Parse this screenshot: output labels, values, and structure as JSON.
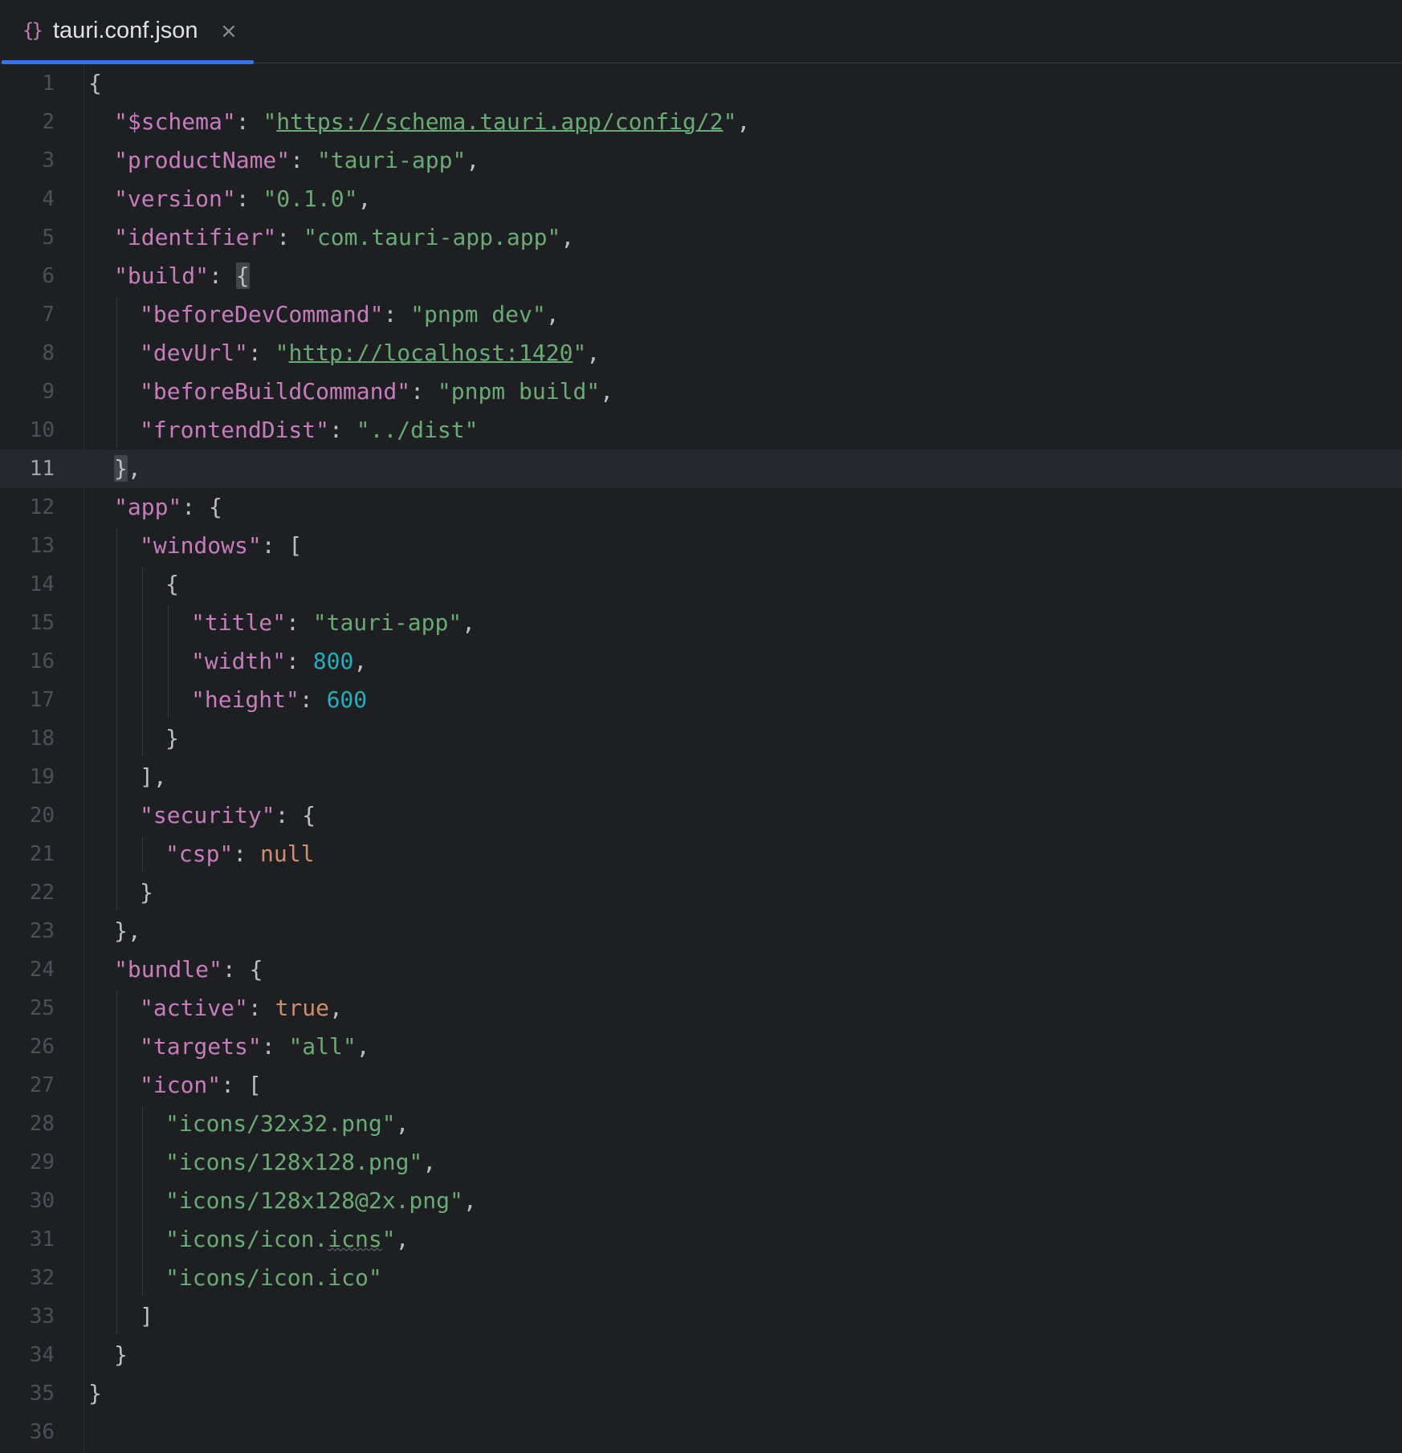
{
  "tab": {
    "icon": "{}",
    "icon_name": "json-braces-icon",
    "label": "tauri.conf.json",
    "close": "×"
  },
  "editor": {
    "current_line": 11,
    "lines": [
      {
        "n": "1",
        "indent": 0,
        "tokens": [
          {
            "t": "{",
            "c": "punc"
          }
        ]
      },
      {
        "n": "2",
        "indent": 1,
        "tokens": [
          {
            "t": "\"$schema\"",
            "c": "key"
          },
          {
            "t": ": ",
            "c": "punc"
          },
          {
            "t": "\"",
            "c": "str"
          },
          {
            "t": "https://schema.tauri.app/config/2",
            "c": "str url"
          },
          {
            "t": "\"",
            "c": "str"
          },
          {
            "t": ",",
            "c": "punc"
          }
        ]
      },
      {
        "n": "3",
        "indent": 1,
        "tokens": [
          {
            "t": "\"productName\"",
            "c": "key"
          },
          {
            "t": ": ",
            "c": "punc"
          },
          {
            "t": "\"tauri-app\"",
            "c": "str"
          },
          {
            "t": ",",
            "c": "punc"
          }
        ]
      },
      {
        "n": "4",
        "indent": 1,
        "tokens": [
          {
            "t": "\"version\"",
            "c": "key"
          },
          {
            "t": ": ",
            "c": "punc"
          },
          {
            "t": "\"0.1.0\"",
            "c": "str"
          },
          {
            "t": ",",
            "c": "punc"
          }
        ]
      },
      {
        "n": "5",
        "indent": 1,
        "tokens": [
          {
            "t": "\"identifier\"",
            "c": "key"
          },
          {
            "t": ": ",
            "c": "punc"
          },
          {
            "t": "\"com.tauri-app.app\"",
            "c": "str"
          },
          {
            "t": ",",
            "c": "punc"
          }
        ]
      },
      {
        "n": "6",
        "indent": 1,
        "tokens": [
          {
            "t": "\"build\"",
            "c": "key"
          },
          {
            "t": ": ",
            "c": "punc"
          },
          {
            "t": "{",
            "c": "punc brace-hl"
          }
        ]
      },
      {
        "n": "7",
        "indent": 2,
        "tokens": [
          {
            "t": "\"beforeDevCommand\"",
            "c": "key"
          },
          {
            "t": ": ",
            "c": "punc"
          },
          {
            "t": "\"pnpm dev\"",
            "c": "str"
          },
          {
            "t": ",",
            "c": "punc"
          }
        ]
      },
      {
        "n": "8",
        "indent": 2,
        "tokens": [
          {
            "t": "\"devUrl\"",
            "c": "key"
          },
          {
            "t": ": ",
            "c": "punc"
          },
          {
            "t": "\"",
            "c": "str"
          },
          {
            "t": "http://localhost:1420",
            "c": "str url"
          },
          {
            "t": "\"",
            "c": "str"
          },
          {
            "t": ",",
            "c": "punc"
          }
        ]
      },
      {
        "n": "9",
        "indent": 2,
        "tokens": [
          {
            "t": "\"beforeBuildCommand\"",
            "c": "key"
          },
          {
            "t": ": ",
            "c": "punc"
          },
          {
            "t": "\"pnpm build\"",
            "c": "str"
          },
          {
            "t": ",",
            "c": "punc"
          }
        ]
      },
      {
        "n": "10",
        "indent": 2,
        "tokens": [
          {
            "t": "\"frontendDist\"",
            "c": "key"
          },
          {
            "t": ": ",
            "c": "punc"
          },
          {
            "t": "\"../dist\"",
            "c": "str"
          }
        ]
      },
      {
        "n": "11",
        "indent": 1,
        "tokens": [
          {
            "t": "}",
            "c": "punc brace-hl"
          },
          {
            "t": ",",
            "c": "punc"
          }
        ]
      },
      {
        "n": "12",
        "indent": 1,
        "tokens": [
          {
            "t": "\"app\"",
            "c": "key"
          },
          {
            "t": ": {",
            "c": "punc"
          }
        ]
      },
      {
        "n": "13",
        "indent": 2,
        "tokens": [
          {
            "t": "\"windows\"",
            "c": "key"
          },
          {
            "t": ": [",
            "c": "punc"
          }
        ]
      },
      {
        "n": "14",
        "indent": 3,
        "tokens": [
          {
            "t": "{",
            "c": "punc"
          }
        ]
      },
      {
        "n": "15",
        "indent": 4,
        "tokens": [
          {
            "t": "\"title\"",
            "c": "key"
          },
          {
            "t": ": ",
            "c": "punc"
          },
          {
            "t": "\"tauri-app\"",
            "c": "str"
          },
          {
            "t": ",",
            "c": "punc"
          }
        ]
      },
      {
        "n": "16",
        "indent": 4,
        "tokens": [
          {
            "t": "\"width\"",
            "c": "key"
          },
          {
            "t": ": ",
            "c": "punc"
          },
          {
            "t": "800",
            "c": "num"
          },
          {
            "t": ",",
            "c": "punc"
          }
        ]
      },
      {
        "n": "17",
        "indent": 4,
        "tokens": [
          {
            "t": "\"height\"",
            "c": "key"
          },
          {
            "t": ": ",
            "c": "punc"
          },
          {
            "t": "600",
            "c": "num"
          }
        ]
      },
      {
        "n": "18",
        "indent": 3,
        "tokens": [
          {
            "t": "}",
            "c": "punc"
          }
        ]
      },
      {
        "n": "19",
        "indent": 2,
        "tokens": [
          {
            "t": "],",
            "c": "punc"
          }
        ]
      },
      {
        "n": "20",
        "indent": 2,
        "tokens": [
          {
            "t": "\"security\"",
            "c": "key"
          },
          {
            "t": ": {",
            "c": "punc"
          }
        ]
      },
      {
        "n": "21",
        "indent": 3,
        "tokens": [
          {
            "t": "\"csp\"",
            "c": "key"
          },
          {
            "t": ": ",
            "c": "punc"
          },
          {
            "t": "null",
            "c": "kw"
          }
        ]
      },
      {
        "n": "22",
        "indent": 2,
        "tokens": [
          {
            "t": "}",
            "c": "punc"
          }
        ]
      },
      {
        "n": "23",
        "indent": 1,
        "tokens": [
          {
            "t": "},",
            "c": "punc"
          }
        ]
      },
      {
        "n": "24",
        "indent": 1,
        "tokens": [
          {
            "t": "\"bundle\"",
            "c": "key"
          },
          {
            "t": ": {",
            "c": "punc"
          }
        ]
      },
      {
        "n": "25",
        "indent": 2,
        "tokens": [
          {
            "t": "\"active\"",
            "c": "key"
          },
          {
            "t": ": ",
            "c": "punc"
          },
          {
            "t": "true",
            "c": "kw"
          },
          {
            "t": ",",
            "c": "punc"
          }
        ]
      },
      {
        "n": "26",
        "indent": 2,
        "tokens": [
          {
            "t": "\"targets\"",
            "c": "key"
          },
          {
            "t": ": ",
            "c": "punc"
          },
          {
            "t": "\"all\"",
            "c": "str"
          },
          {
            "t": ",",
            "c": "punc"
          }
        ]
      },
      {
        "n": "27",
        "indent": 2,
        "tokens": [
          {
            "t": "\"icon\"",
            "c": "key"
          },
          {
            "t": ": [",
            "c": "punc"
          }
        ]
      },
      {
        "n": "28",
        "indent": 3,
        "tokens": [
          {
            "t": "\"icons/32x32.png\"",
            "c": "str"
          },
          {
            "t": ",",
            "c": "punc"
          }
        ]
      },
      {
        "n": "29",
        "indent": 3,
        "tokens": [
          {
            "t": "\"icons/128x128.png\"",
            "c": "str"
          },
          {
            "t": ",",
            "c": "punc"
          }
        ]
      },
      {
        "n": "30",
        "indent": 3,
        "tokens": [
          {
            "t": "\"icons/128x128@2x.png\"",
            "c": "str"
          },
          {
            "t": ",",
            "c": "punc"
          }
        ]
      },
      {
        "n": "31",
        "indent": 3,
        "tokens": [
          {
            "t": "\"icons/icon.",
            "c": "str"
          },
          {
            "t": "icns",
            "c": "str squiggle"
          },
          {
            "t": "\"",
            "c": "str"
          },
          {
            "t": ",",
            "c": "punc"
          }
        ]
      },
      {
        "n": "32",
        "indent": 3,
        "tokens": [
          {
            "t": "\"icons/icon.ico\"",
            "c": "str"
          }
        ]
      },
      {
        "n": "33",
        "indent": 2,
        "tokens": [
          {
            "t": "]",
            "c": "punc"
          }
        ]
      },
      {
        "n": "34",
        "indent": 1,
        "tokens": [
          {
            "t": "}",
            "c": "punc"
          }
        ]
      },
      {
        "n": "35",
        "indent": 0,
        "tokens": [
          {
            "t": "}",
            "c": "punc"
          }
        ]
      },
      {
        "n": "36",
        "indent": 0,
        "tokens": []
      }
    ]
  },
  "colors": {
    "background": "#1e1f22",
    "current_line": "#26282e",
    "key": "#c77dbb",
    "string": "#6aab73",
    "number": "#2aacb8",
    "keyword": "#cf8e6d",
    "punctuation": "#bcbec4",
    "tab_accent": "#3574f0"
  }
}
